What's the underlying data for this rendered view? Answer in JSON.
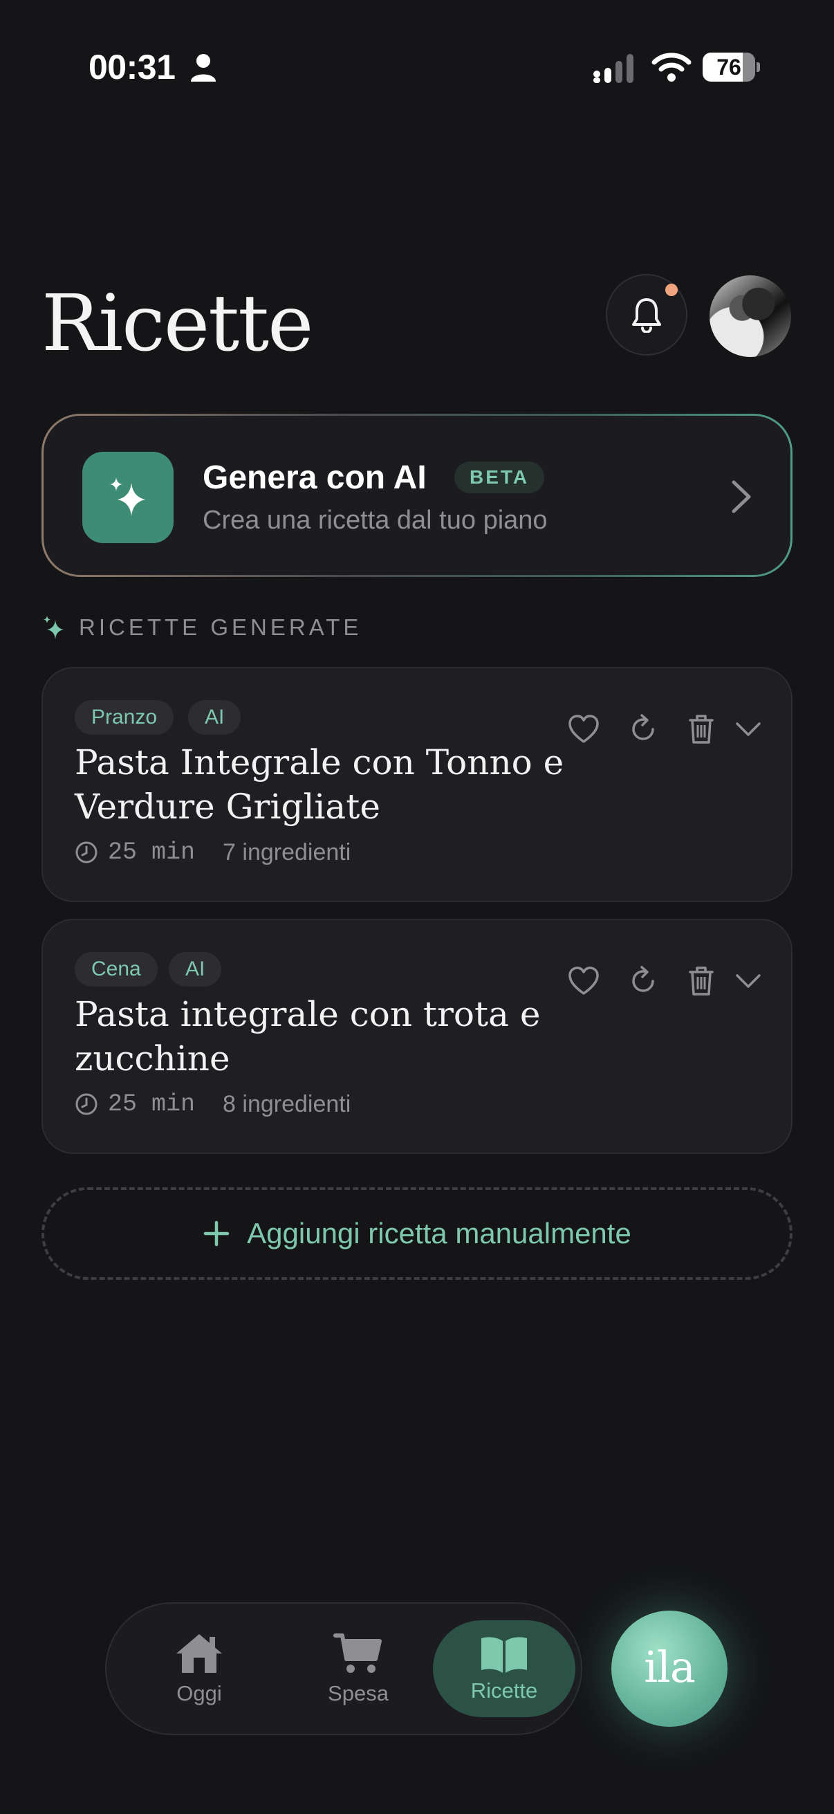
{
  "status_bar": {
    "time": "00:31",
    "battery": "76",
    "battery_level": 0.76
  },
  "header": {
    "title": "Ricette"
  },
  "ai_card": {
    "title": "Genera con AI",
    "badge": "BETA",
    "subtitle": "Crea una ricetta dal tuo piano"
  },
  "section": {
    "label": "RICETTE GENERATE"
  },
  "recipes": [
    {
      "tags": [
        "Pranzo",
        "AI"
      ],
      "title": "Pasta Integrale con Tonno e Verdure Grigliate",
      "time": "25 min",
      "ingredients": "7 ingredienti"
    },
    {
      "tags": [
        "Cena",
        "AI"
      ],
      "title": "Pasta integrale con trota e zucchine",
      "time": "25 min",
      "ingredients": "8 ingredienti"
    }
  ],
  "add_button": {
    "label": "Aggiungi ricetta manualmente"
  },
  "nav": {
    "items": [
      {
        "label": "Oggi"
      },
      {
        "label": "Spesa"
      },
      {
        "label": "Ricette"
      }
    ]
  },
  "assistant": {
    "label": "ila"
  },
  "colors": {
    "background": "#151518",
    "accent": "#7ec8ad",
    "accent_dark": "#3f8c74",
    "notification": "#f0a57e"
  }
}
